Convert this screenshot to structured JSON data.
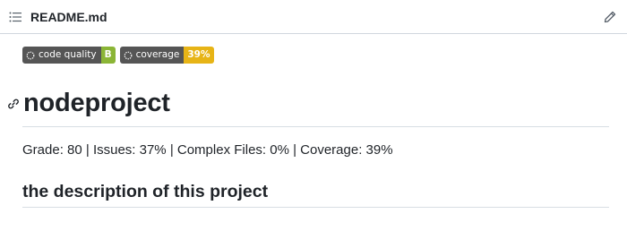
{
  "header": {
    "toc_icon": "list-icon",
    "file_name": "README.md",
    "edit_icon": "pencil-icon"
  },
  "badges": [
    {
      "label": "code quality",
      "value": "B",
      "value_color": "#8bb536",
      "icon": "dotted-ring-icon"
    },
    {
      "label": "coverage",
      "value": "39%",
      "value_color": "#e7b416",
      "icon": "dotted-ring-icon"
    }
  ],
  "content": {
    "heading": "nodeproject",
    "anchor_icon": "link-icon",
    "paragraph": "Grade: 80 | Issues: 37% | Complex Files: 0% | Coverage: 39%",
    "subheading": "the description of this project"
  },
  "colors": {
    "badge_label_bg": "#555555",
    "text": "#1f2328",
    "rule": "#d8dee4"
  }
}
